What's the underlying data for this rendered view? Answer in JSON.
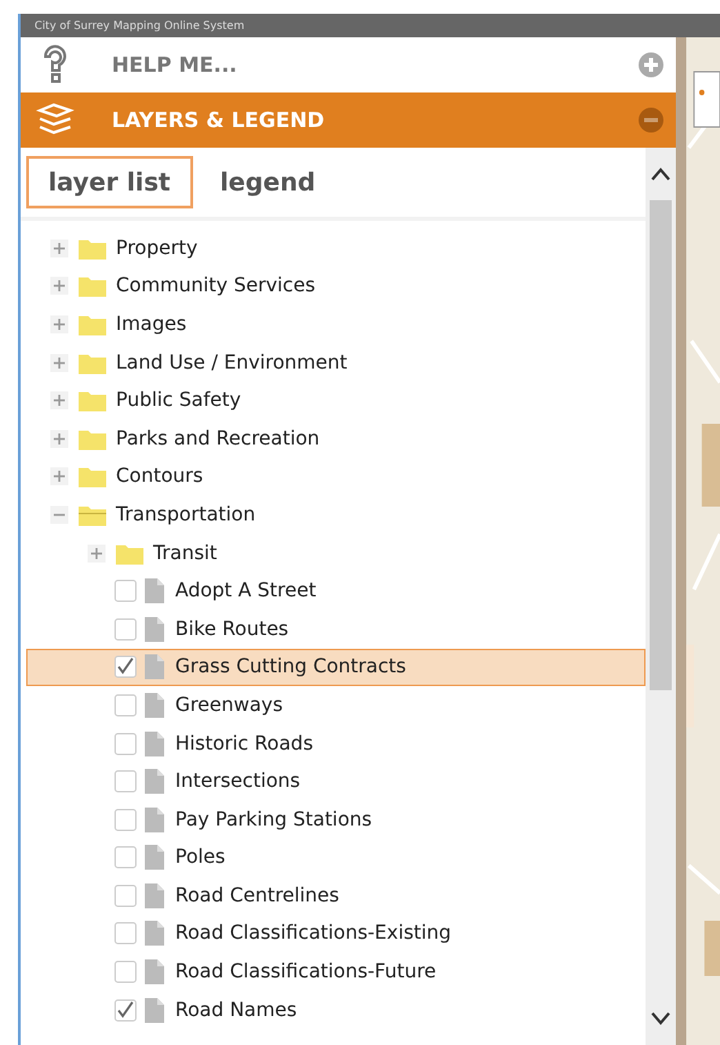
{
  "window": {
    "title": "City of Surrey Mapping Online System"
  },
  "sections": [
    {
      "title": "HELP ME...",
      "expanded": false
    },
    {
      "title": "LAYERS & LEGEND",
      "expanded": true
    }
  ],
  "tabs": [
    {
      "label": "layer list",
      "selected": true
    },
    {
      "label": "legend",
      "selected": false
    }
  ],
  "tree": [
    {
      "kind": "folder",
      "label": "Property",
      "expanded": false,
      "selected": false
    },
    {
      "kind": "folder",
      "label": "Community Services",
      "expanded": false,
      "selected": false
    },
    {
      "kind": "folder",
      "label": "Images",
      "expanded": false,
      "selected": false
    },
    {
      "kind": "folder",
      "label": "Land Use / Environment",
      "expanded": false,
      "selected": false
    },
    {
      "kind": "folder",
      "label": "Public Safety",
      "expanded": false,
      "selected": false
    },
    {
      "kind": "folder",
      "label": "Parks and Recreation",
      "expanded": false,
      "selected": false
    },
    {
      "kind": "folder",
      "label": "Contours",
      "expanded": false,
      "selected": false
    },
    {
      "kind": "folder",
      "label": "Transportation",
      "expanded": true,
      "selected": false,
      "children": [
        {
          "kind": "folder",
          "label": "Transit",
          "expanded": false,
          "selected": false
        },
        {
          "kind": "layer",
          "label": "Adopt A Street",
          "checked": false,
          "selected": false
        },
        {
          "kind": "layer",
          "label": "Bike Routes",
          "checked": false,
          "selected": false
        },
        {
          "kind": "layer",
          "label": "Grass Cutting Contracts",
          "checked": true,
          "selected": true
        },
        {
          "kind": "layer",
          "label": "Greenways",
          "checked": false,
          "selected": false
        },
        {
          "kind": "layer",
          "label": "Historic Roads",
          "checked": false,
          "selected": false
        },
        {
          "kind": "layer",
          "label": "Intersections",
          "checked": false,
          "selected": false
        },
        {
          "kind": "layer",
          "label": "Pay Parking Stations",
          "checked": false,
          "selected": false
        },
        {
          "kind": "layer",
          "label": "Poles",
          "checked": false,
          "selected": false
        },
        {
          "kind": "layer",
          "label": "Road Centrelines",
          "checked": false,
          "selected": false
        },
        {
          "kind": "layer",
          "label": "Road Classifications-Existing",
          "checked": false,
          "selected": false
        },
        {
          "kind": "layer",
          "label": "Road Classifications-Future",
          "checked": false,
          "selected": false
        },
        {
          "kind": "layer",
          "label": "Road Names",
          "checked": true,
          "selected": false
        }
      ]
    }
  ]
}
